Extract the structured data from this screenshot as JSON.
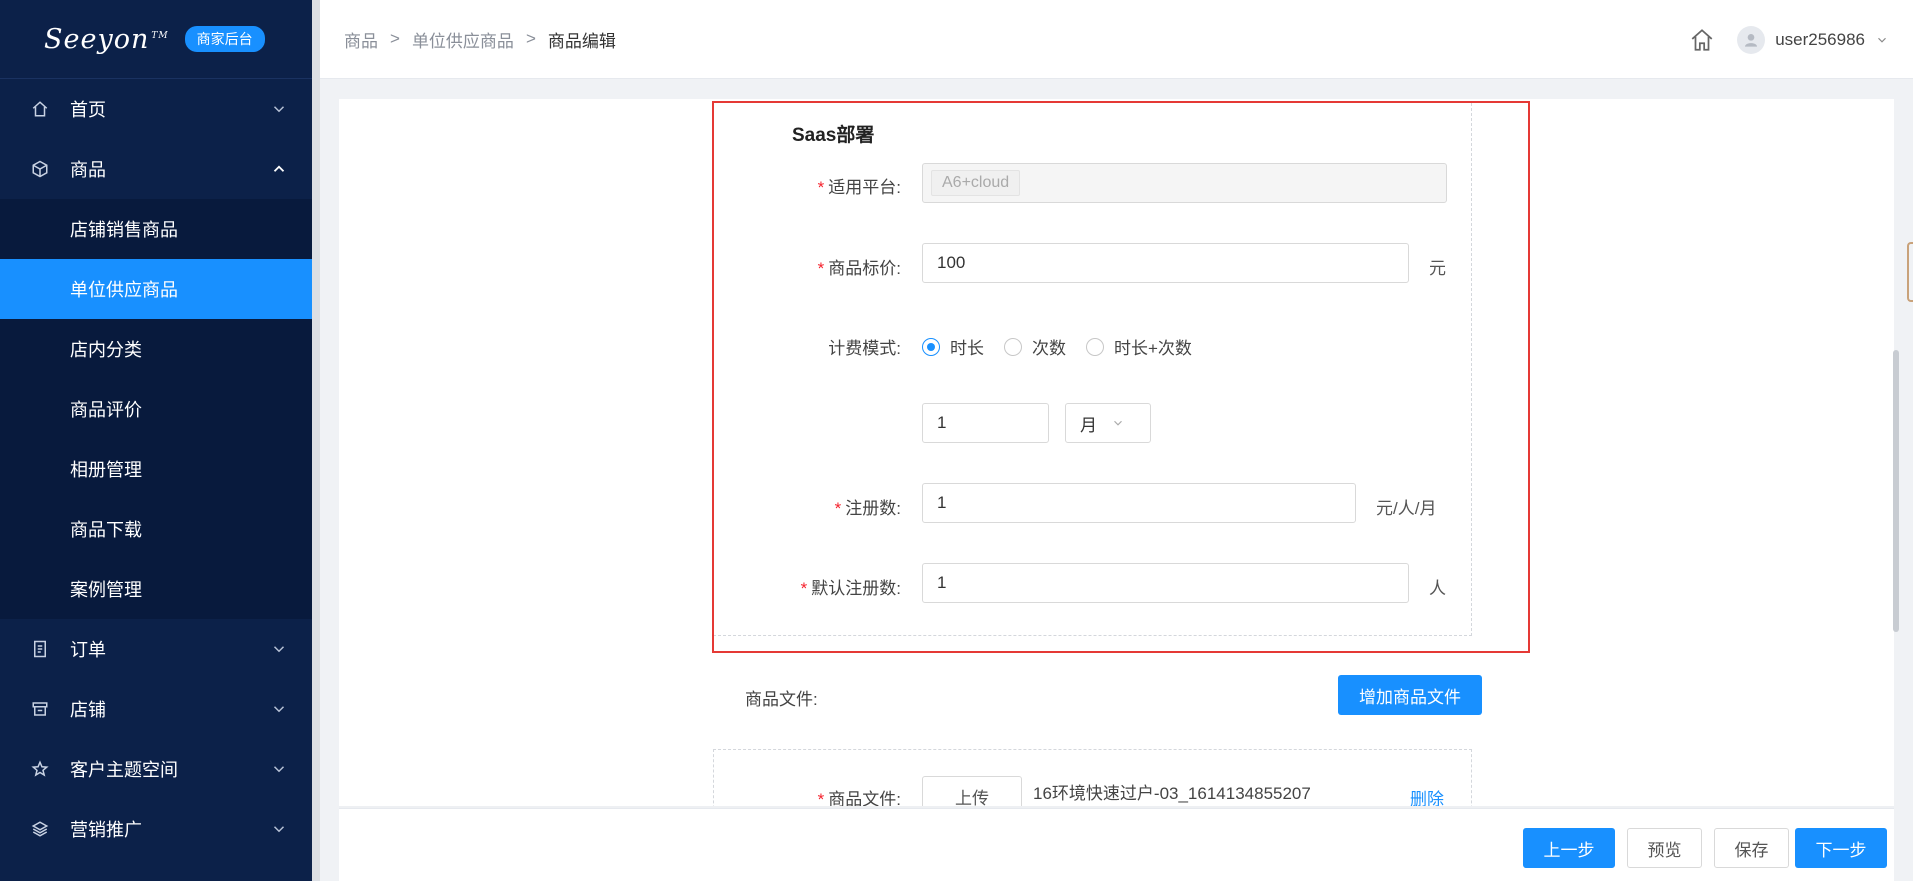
{
  "sidebar": {
    "logo": "Seeyon",
    "logo_tm": "TM",
    "badge": "商家后台",
    "menu": {
      "home": "首页",
      "goods": "商品",
      "orders": "订单",
      "store": "店铺",
      "customer_space": "客户主题空间",
      "marketing": "营销推广"
    },
    "goods_submenu": [
      "店铺销售商品",
      "单位供应商品",
      "店内分类",
      "商品评价",
      "相册管理",
      "商品下载",
      "案例管理"
    ],
    "active_submenu": "单位供应商品"
  },
  "header": {
    "breadcrumb": [
      "商品",
      "单位供应商品",
      "商品编辑"
    ],
    "separator": ">",
    "username": "user256986"
  },
  "form": {
    "section_title": "Saas部署",
    "required_mark": "*",
    "platform_label": "适用平台:",
    "platform_tag": "A6+cloud",
    "price_label": "商品标价:",
    "price_value": "100",
    "price_unit": "元",
    "billing_label": "计费模式:",
    "billing_options": [
      "时长",
      "次数",
      "时长+次数"
    ],
    "billing_selected": "时长",
    "duration_value": "1",
    "duration_unit": "月",
    "reg_label": "注册数:",
    "reg_value": "1",
    "reg_unit": "元/人/月",
    "default_reg_label": "默认注册数:",
    "default_reg_value": "1",
    "default_reg_unit": "人"
  },
  "files": {
    "section_label": "商品文件:",
    "add_button": "增加商品文件",
    "file_label": "商品文件:",
    "upload_button": "上传",
    "file_name": "16环境快速过户-03_1614134855207",
    "delete_link": "删除"
  },
  "footer": {
    "prev": "上一步",
    "preview": "预览",
    "save": "保存",
    "next": "下一步"
  }
}
